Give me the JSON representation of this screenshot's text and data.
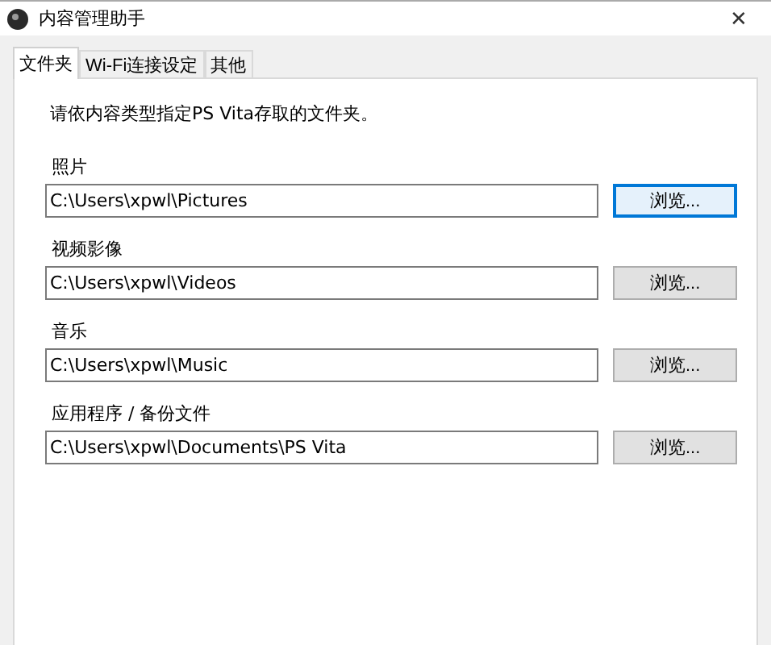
{
  "window": {
    "title": "内容管理助手",
    "close": "✕"
  },
  "tabs": [
    {
      "label": "文件夹",
      "selected": true
    },
    {
      "label": "Wi-Fi连接设定",
      "selected": false
    },
    {
      "label": "其他",
      "selected": false
    }
  ],
  "instruction": "请依内容类型指定PS Vita存取的文件夹。",
  "folders": [
    {
      "label": "照片",
      "value": "C:\\Users\\xpwl\\Pictures",
      "button": "浏览...",
      "focused": true
    },
    {
      "label": "视频影像",
      "value": "C:\\Users\\xpwl\\Videos",
      "button": "浏览...",
      "focused": false
    },
    {
      "label": "音乐",
      "value": "C:\\Users\\xpwl\\Music",
      "button": "浏览...",
      "focused": false
    },
    {
      "label": "应用程序 / 备份文件",
      "value": "C:\\Users\\xpwl\\Documents\\PS Vita",
      "button": "浏览...",
      "focused": false
    }
  ]
}
